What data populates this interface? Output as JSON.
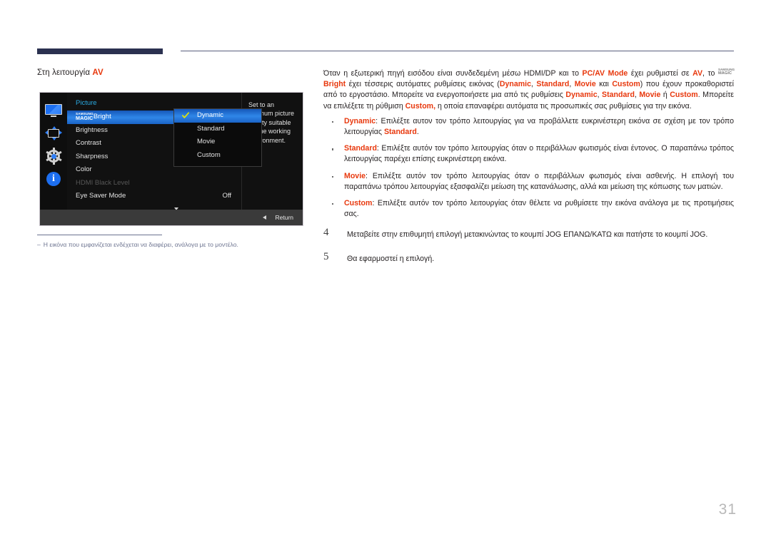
{
  "page": {
    "number": "31"
  },
  "left": {
    "heading_prefix": "Στη λειτουργία ",
    "heading_accent": "AV",
    "footnote_dash": "‒",
    "footnote_text": "Η εικόνα που εμφανίζεται ενδέχεται να διαφέρει, ανάλογα με το μοντέλο."
  },
  "osd": {
    "title": "Picture",
    "icons": [
      {
        "name": "monitor-icon",
        "label": "Picture"
      },
      {
        "name": "picture-position-arrows-icon",
        "label": "OnScreen Display"
      },
      {
        "name": "gear-icon",
        "label": "System"
      },
      {
        "name": "info-icon",
        "label": "Information"
      }
    ],
    "menu_items": [
      {
        "label_logo": true,
        "logo_line1": "SAMSUNG",
        "logo_line2": "MAGIC",
        "label": "Bright",
        "value": "",
        "selected": true,
        "disabled": false
      },
      {
        "label": "Brightness",
        "value": "",
        "selected": false,
        "disabled": false
      },
      {
        "label": "Contrast",
        "value": "",
        "selected": false,
        "disabled": false
      },
      {
        "label": "Sharpness",
        "value": "",
        "selected": false,
        "disabled": false
      },
      {
        "label": "Color",
        "value": "",
        "selected": false,
        "disabled": false
      },
      {
        "label": "HDMI Black Level",
        "value": "",
        "selected": false,
        "disabled": true
      },
      {
        "label": "Eye Saver Mode",
        "value": "Off",
        "selected": false,
        "disabled": false
      }
    ],
    "submenu_options": [
      {
        "label": "Dynamic",
        "checked": true
      },
      {
        "label": "Standard",
        "checked": false
      },
      {
        "label": "Movie",
        "checked": false
      },
      {
        "label": "Custom",
        "checked": false
      }
    ],
    "description": "Set to an optimum picture quality suitable for the working environment.",
    "return_label": "Return",
    "colors": {
      "highlight_blue": "#2f86e8",
      "title_cyan": "#2aa9e0",
      "check_yellow": "#e8e800",
      "background": "#111111",
      "footer": "#3a3a3a"
    }
  },
  "right": {
    "intro": {
      "p1": "Όταν η εξωτερική πηγή εισόδου είναι συνδεδεμένη μέσω HDMI/DP και το ",
      "pcav": "PC/AV Mode",
      "p2": " έχει ρυθμιστεί σε ",
      "av": "AV",
      "p3": ", το ",
      "logo_line1": "SAMSUNG",
      "logo_line2": "MAGIC",
      "bright": "Bright",
      "p4": " έχει τέσσερις αυτόματες ρυθμίσεις εικόνας (",
      "dynamic": "Dynamic",
      "sep1": ", ",
      "standard": "Standard",
      "sep2": ", ",
      "movie": "Movie",
      "sep3": " και ",
      "custom": "Custom",
      "p5": ") που έχουν προκαθοριστεί από το εργοστάσιο. Μπορείτε να ενεργοποιήσετε μια από τις ρυθμίσεις ",
      "dynamic2": "Dynamic",
      "sep4": ", ",
      "standard2": "Standard",
      "p6": ", ",
      "movie2": "Movie",
      "sep5": " ή ",
      "custom2": "Custom",
      "p7": ". Μπορείτε να επιλέξετε τη ρύθμιση ",
      "custom3": "Custom,",
      "p8": " η οποία επαναφέρει αυτόματα τις προσωπικές σας ρυθμίσεις για την εικόνα."
    },
    "bullets": [
      {
        "term": "Dynamic",
        "text_a": ": Επιλέξτε αυτον τον τρόπο λειτουργίας για να προβάλλετε ευκρινέστερη εικόνα σε σχέση με τον τρόπο λειτουργίας ",
        "term_b": "Standard",
        "text_b": "."
      },
      {
        "term": "Standard",
        "text_a": ": Επιλέξτε αυτόν τον τρόπο λειτουργίας όταν ο περιβάλλων φωτισμός είναι έντονος. Ο παραπάνω τρόπος λειτουργίας παρέχει επίσης ευκρινέστερη εικόνα.",
        "term_b": "",
        "text_b": ""
      },
      {
        "term": "Movie",
        "text_a": ": Επιλέξτε αυτόν τον τρόπο λειτουργίας όταν ο περιβάλλων φωτισμός είναι ασθενής. Η επιλογή του παραπάνω τρόπου λειτουργίας εξασφαλίζει μείωση της κατανάλωσης, αλλά και μείωση της κόπωσης των ματιών.",
        "term_b": "",
        "text_b": ""
      },
      {
        "term": "Custom",
        "text_a": ": Επιλέξτε αυτόν τον τρόπο λειτουργίας όταν θέλετε να ρυθμίσετε την εικόνα ανάλογα με τις προτιμήσεις σας.",
        "term_b": "",
        "text_b": ""
      }
    ],
    "steps": [
      {
        "num": "4",
        "text": "Μεταβείτε στην επιθυμητή επιλογή μετακινώντας το κουμπί JOG ΕΠΑΝΩ/ΚΑΤΩ και πατήστε το κουμπί JOG."
      },
      {
        "num": "5",
        "text": "Θα εφαρμοστεί η επιλογή."
      }
    ]
  }
}
